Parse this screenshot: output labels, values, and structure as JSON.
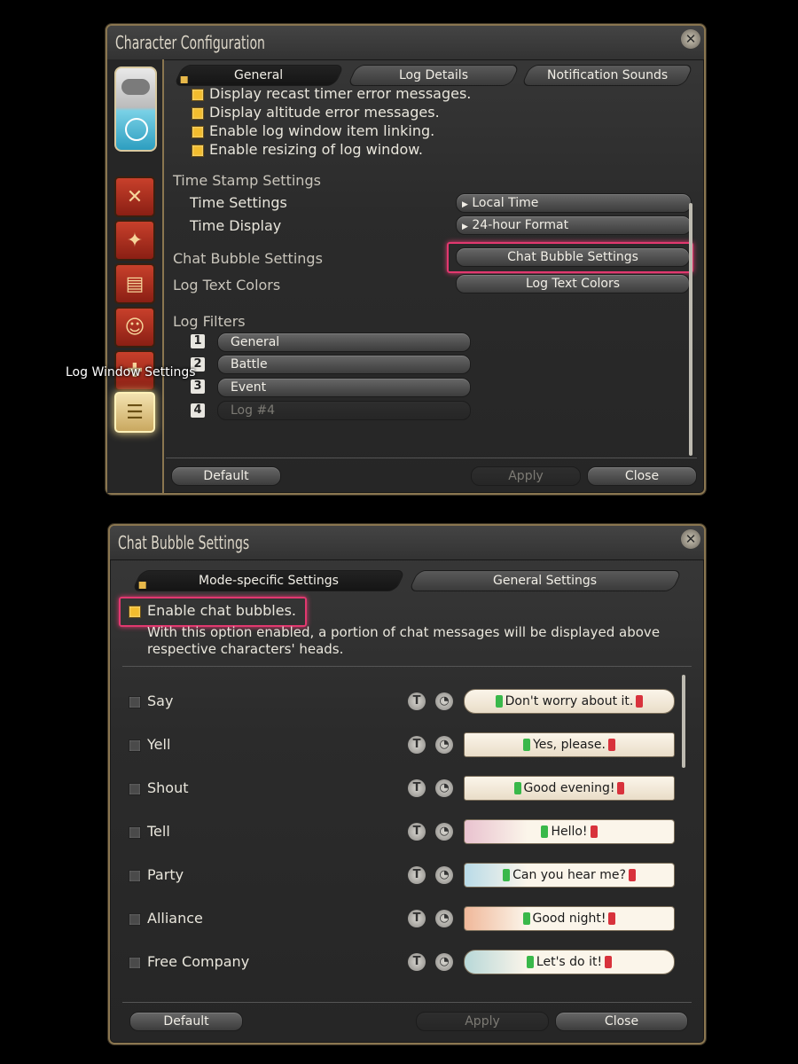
{
  "char_config": {
    "title": "Character Configuration",
    "close_icon": "close-x",
    "tabs": [
      {
        "label": "General"
      },
      {
        "label": "Log Details"
      },
      {
        "label": "Notification Sounds"
      }
    ],
    "checkboxes": [
      {
        "label": "Display recast timer error messages.",
        "checked": true
      },
      {
        "label": "Display altitude error messages.",
        "checked": true
      },
      {
        "label": "Enable log window item linking.",
        "checked": true
      },
      {
        "label": "Enable resizing of log window.",
        "checked": true
      }
    ],
    "timestamp_header": "Time Stamp Settings",
    "time_settings_label": "Time Settings",
    "time_settings_value": "Local Time",
    "time_display_label": "Time Display",
    "time_display_value": "24-hour Format",
    "chat_bubble_label": "Chat Bubble Settings",
    "chat_bubble_button": "Chat Bubble Settings",
    "log_text_colors_label": "Log Text Colors",
    "log_text_colors_button": "Log Text Colors",
    "log_filters_header": "Log Filters",
    "log_filters": [
      {
        "num": "1",
        "label": "General"
      },
      {
        "num": "2",
        "label": "Battle"
      },
      {
        "num": "3",
        "label": "Event"
      },
      {
        "num": "4",
        "label": "Log #4"
      }
    ],
    "tooltip": "Log Window Settings",
    "buttons": {
      "default": "Default",
      "apply": "Apply",
      "close": "Close"
    }
  },
  "chat_bubble": {
    "title": "Chat Bubble Settings",
    "close_icon": "close-x",
    "tabs": [
      {
        "label": "Mode-specific Settings"
      },
      {
        "label": "General Settings"
      }
    ],
    "enable_label": "Enable chat bubbles.",
    "enable_checked": true,
    "description_line1": "With this option enabled, a portion of chat messages will be displayed above",
    "description_line2": "respective characters' heads.",
    "modes": [
      {
        "label": "Say",
        "preview": "Don't worry about it."
      },
      {
        "label": "Yell",
        "preview": "Yes, please."
      },
      {
        "label": "Shout",
        "preview": "Good evening!"
      },
      {
        "label": "Tell",
        "preview": "Hello!"
      },
      {
        "label": "Party",
        "preview": "Can you hear me?"
      },
      {
        "label": "Alliance",
        "preview": "Good night!"
      },
      {
        "label": "Free Company",
        "preview": "Let's do it!"
      }
    ],
    "t_icon": "T",
    "buttons": {
      "default": "Default",
      "apply": "Apply",
      "close": "Close"
    }
  },
  "colors": {
    "accent": "#f2bc2e",
    "highlight": "#e2386f",
    "frame": "#8a7650"
  }
}
